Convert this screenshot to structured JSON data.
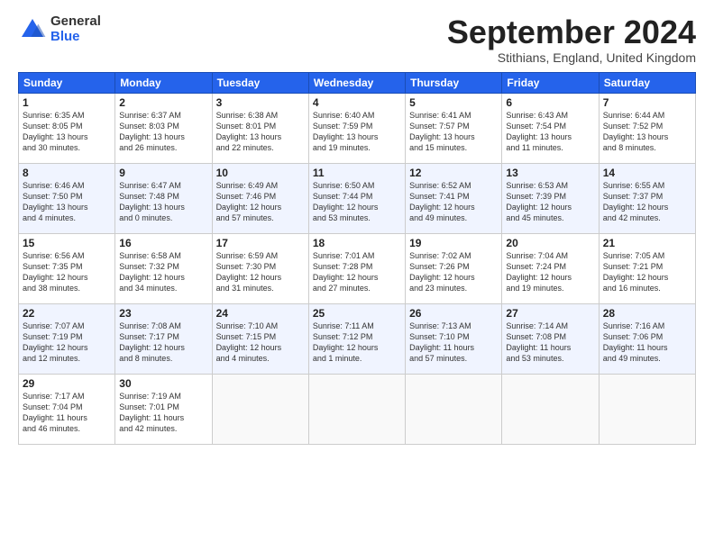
{
  "logo": {
    "general": "General",
    "blue": "Blue"
  },
  "header": {
    "month": "September 2024",
    "location": "Stithians, England, United Kingdom"
  },
  "weekdays": [
    "Sunday",
    "Monday",
    "Tuesday",
    "Wednesday",
    "Thursday",
    "Friday",
    "Saturday"
  ],
  "weeks": [
    [
      {
        "day": "1",
        "lines": [
          "Sunrise: 6:35 AM",
          "Sunset: 8:05 PM",
          "Daylight: 13 hours",
          "and 30 minutes."
        ]
      },
      {
        "day": "2",
        "lines": [
          "Sunrise: 6:37 AM",
          "Sunset: 8:03 PM",
          "Daylight: 13 hours",
          "and 26 minutes."
        ]
      },
      {
        "day": "3",
        "lines": [
          "Sunrise: 6:38 AM",
          "Sunset: 8:01 PM",
          "Daylight: 13 hours",
          "and 22 minutes."
        ]
      },
      {
        "day": "4",
        "lines": [
          "Sunrise: 6:40 AM",
          "Sunset: 7:59 PM",
          "Daylight: 13 hours",
          "and 19 minutes."
        ]
      },
      {
        "day": "5",
        "lines": [
          "Sunrise: 6:41 AM",
          "Sunset: 7:57 PM",
          "Daylight: 13 hours",
          "and 15 minutes."
        ]
      },
      {
        "day": "6",
        "lines": [
          "Sunrise: 6:43 AM",
          "Sunset: 7:54 PM",
          "Daylight: 13 hours",
          "and 11 minutes."
        ]
      },
      {
        "day": "7",
        "lines": [
          "Sunrise: 6:44 AM",
          "Sunset: 7:52 PM",
          "Daylight: 13 hours",
          "and 8 minutes."
        ]
      }
    ],
    [
      {
        "day": "8",
        "lines": [
          "Sunrise: 6:46 AM",
          "Sunset: 7:50 PM",
          "Daylight: 13 hours",
          "and 4 minutes."
        ]
      },
      {
        "day": "9",
        "lines": [
          "Sunrise: 6:47 AM",
          "Sunset: 7:48 PM",
          "Daylight: 13 hours",
          "and 0 minutes."
        ]
      },
      {
        "day": "10",
        "lines": [
          "Sunrise: 6:49 AM",
          "Sunset: 7:46 PM",
          "Daylight: 12 hours",
          "and 57 minutes."
        ]
      },
      {
        "day": "11",
        "lines": [
          "Sunrise: 6:50 AM",
          "Sunset: 7:44 PM",
          "Daylight: 12 hours",
          "and 53 minutes."
        ]
      },
      {
        "day": "12",
        "lines": [
          "Sunrise: 6:52 AM",
          "Sunset: 7:41 PM",
          "Daylight: 12 hours",
          "and 49 minutes."
        ]
      },
      {
        "day": "13",
        "lines": [
          "Sunrise: 6:53 AM",
          "Sunset: 7:39 PM",
          "Daylight: 12 hours",
          "and 45 minutes."
        ]
      },
      {
        "day": "14",
        "lines": [
          "Sunrise: 6:55 AM",
          "Sunset: 7:37 PM",
          "Daylight: 12 hours",
          "and 42 minutes."
        ]
      }
    ],
    [
      {
        "day": "15",
        "lines": [
          "Sunrise: 6:56 AM",
          "Sunset: 7:35 PM",
          "Daylight: 12 hours",
          "and 38 minutes."
        ]
      },
      {
        "day": "16",
        "lines": [
          "Sunrise: 6:58 AM",
          "Sunset: 7:32 PM",
          "Daylight: 12 hours",
          "and 34 minutes."
        ]
      },
      {
        "day": "17",
        "lines": [
          "Sunrise: 6:59 AM",
          "Sunset: 7:30 PM",
          "Daylight: 12 hours",
          "and 31 minutes."
        ]
      },
      {
        "day": "18",
        "lines": [
          "Sunrise: 7:01 AM",
          "Sunset: 7:28 PM",
          "Daylight: 12 hours",
          "and 27 minutes."
        ]
      },
      {
        "day": "19",
        "lines": [
          "Sunrise: 7:02 AM",
          "Sunset: 7:26 PM",
          "Daylight: 12 hours",
          "and 23 minutes."
        ]
      },
      {
        "day": "20",
        "lines": [
          "Sunrise: 7:04 AM",
          "Sunset: 7:24 PM",
          "Daylight: 12 hours",
          "and 19 minutes."
        ]
      },
      {
        "day": "21",
        "lines": [
          "Sunrise: 7:05 AM",
          "Sunset: 7:21 PM",
          "Daylight: 12 hours",
          "and 16 minutes."
        ]
      }
    ],
    [
      {
        "day": "22",
        "lines": [
          "Sunrise: 7:07 AM",
          "Sunset: 7:19 PM",
          "Daylight: 12 hours",
          "and 12 minutes."
        ]
      },
      {
        "day": "23",
        "lines": [
          "Sunrise: 7:08 AM",
          "Sunset: 7:17 PM",
          "Daylight: 12 hours",
          "and 8 minutes."
        ]
      },
      {
        "day": "24",
        "lines": [
          "Sunrise: 7:10 AM",
          "Sunset: 7:15 PM",
          "Daylight: 12 hours",
          "and 4 minutes."
        ]
      },
      {
        "day": "25",
        "lines": [
          "Sunrise: 7:11 AM",
          "Sunset: 7:12 PM",
          "Daylight: 12 hours",
          "and 1 minute."
        ]
      },
      {
        "day": "26",
        "lines": [
          "Sunrise: 7:13 AM",
          "Sunset: 7:10 PM",
          "Daylight: 11 hours",
          "and 57 minutes."
        ]
      },
      {
        "day": "27",
        "lines": [
          "Sunrise: 7:14 AM",
          "Sunset: 7:08 PM",
          "Daylight: 11 hours",
          "and 53 minutes."
        ]
      },
      {
        "day": "28",
        "lines": [
          "Sunrise: 7:16 AM",
          "Sunset: 7:06 PM",
          "Daylight: 11 hours",
          "and 49 minutes."
        ]
      }
    ],
    [
      {
        "day": "29",
        "lines": [
          "Sunrise: 7:17 AM",
          "Sunset: 7:04 PM",
          "Daylight: 11 hours",
          "and 46 minutes."
        ]
      },
      {
        "day": "30",
        "lines": [
          "Sunrise: 7:19 AM",
          "Sunset: 7:01 PM",
          "Daylight: 11 hours",
          "and 42 minutes."
        ]
      },
      {
        "day": "",
        "lines": []
      },
      {
        "day": "",
        "lines": []
      },
      {
        "day": "",
        "lines": []
      },
      {
        "day": "",
        "lines": []
      },
      {
        "day": "",
        "lines": []
      }
    ]
  ]
}
